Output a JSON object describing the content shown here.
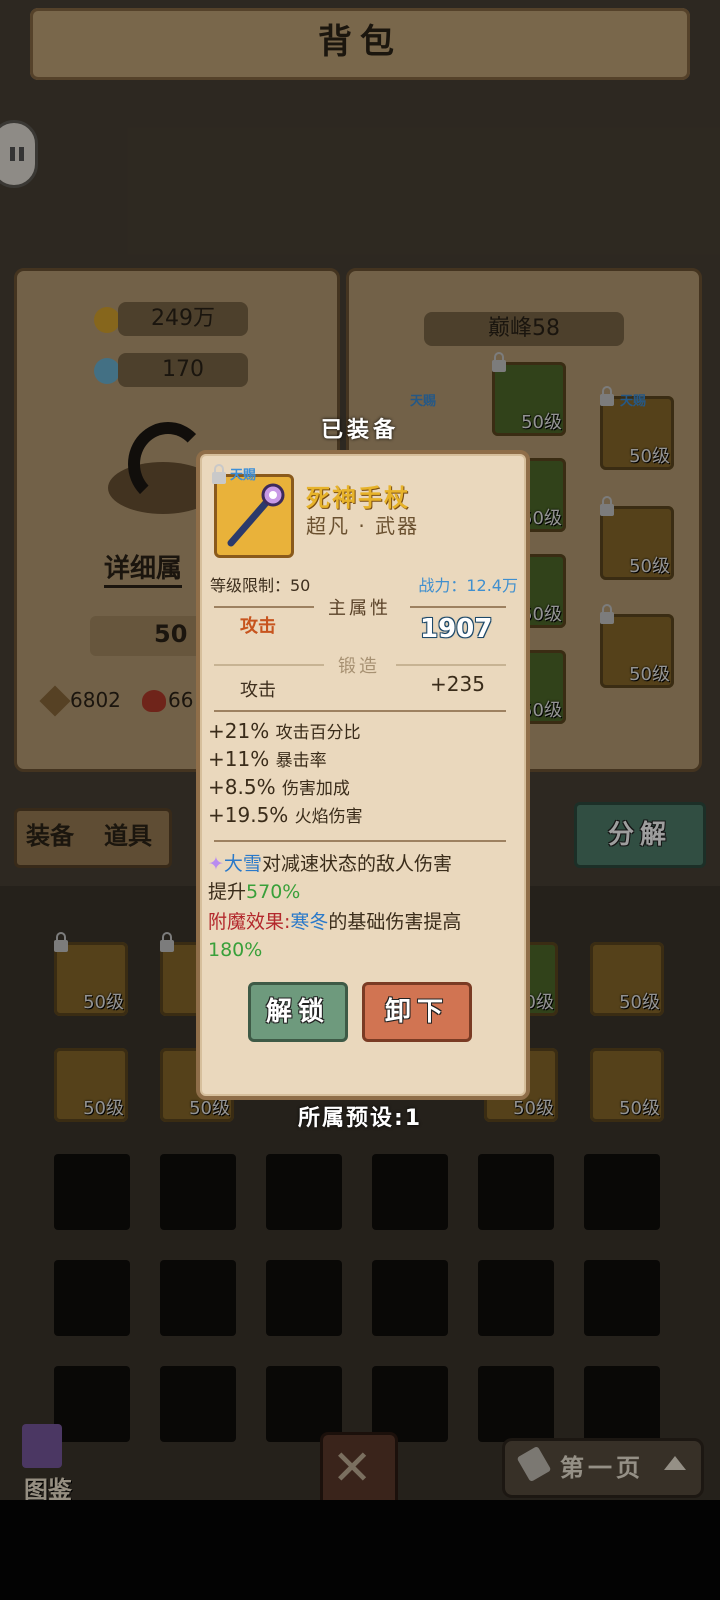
{
  "header": {
    "title": "背包"
  },
  "left_panel": {
    "gold": "249万",
    "gems": "170",
    "detail_label": "详细属",
    "level_value": "50",
    "attack_stat": "6802",
    "hp_stat": "66"
  },
  "right_panel": {
    "peak_label": "巅峰58",
    "slot_level": "50级",
    "gift_tag": "天赐"
  },
  "tabs": {
    "equip": "装备",
    "items": "道具",
    "decompose": "分解"
  },
  "bag": {
    "slot_level": "50级"
  },
  "footer": {
    "codex": "图鉴",
    "page": "第一页"
  },
  "modal": {
    "equipped_label": "已装备",
    "gift_tag": "天赐",
    "item_name": "死神手杖",
    "item_subtitle": "超凡 · 武器",
    "level_limit": "等级限制：50",
    "power": "战力：12.4万",
    "main_attr_title": "主属性",
    "main_attr_label": "攻击",
    "main_attr_value": "1907",
    "forge_title": "锻造",
    "forge_label": "攻击",
    "forge_value": "+235",
    "substats": [
      {
        "value": "+21%",
        "label": "攻击百分比"
      },
      {
        "value": "+11%",
        "label": "暴击率"
      },
      {
        "value": "+8.5%",
        "label": "伤害加成"
      },
      {
        "value": "+19.5%",
        "label": "火焰伤害"
      }
    ],
    "skill": {
      "name": "大雪",
      "text": "对减速状态的敌人伤害",
      "text2": "提升",
      "value": "570%"
    },
    "enchant": {
      "label": "附魔效果:",
      "name": "寒冬",
      "text": "的基础伤害提高",
      "value": "180%"
    },
    "unlock_button": "解锁",
    "remove_button": "卸下",
    "preset": "所属预设:1"
  }
}
